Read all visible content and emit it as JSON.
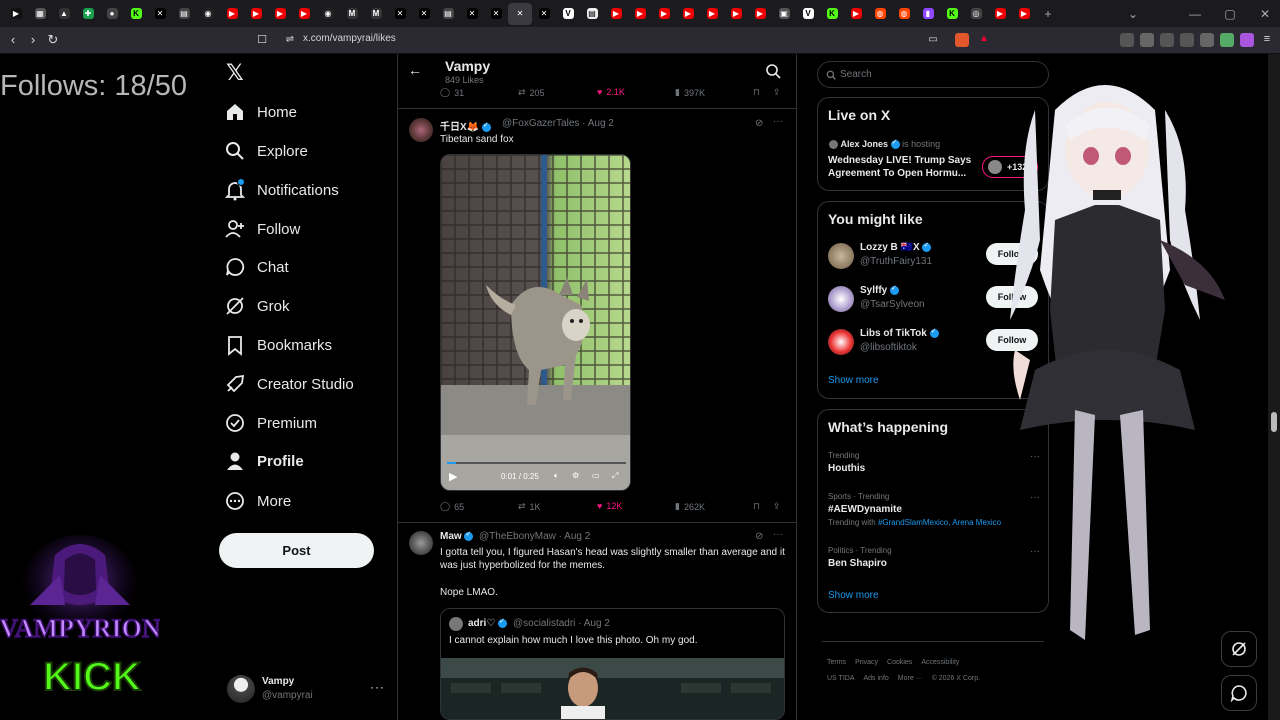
{
  "browser": {
    "url": "x.com/vampyrai/likes",
    "tabs": [
      {
        "icon": "play",
        "color": "#111"
      },
      {
        "icon": "tab",
        "color": "#555"
      },
      {
        "icon": "arrow",
        "color": "#333"
      },
      {
        "icon": "puzzle",
        "color": "#1a9e4f"
      },
      {
        "icon": "globe",
        "color": "#444"
      },
      {
        "icon": "kick",
        "color": "#53fc18"
      },
      {
        "icon": "x",
        "color": "#000"
      },
      {
        "icon": "doc",
        "color": "#444"
      },
      {
        "icon": "github",
        "color": "#222"
      },
      {
        "icon": "youtube",
        "color": "#e00"
      },
      {
        "icon": "youtube",
        "color": "#e00"
      },
      {
        "icon": "youtube",
        "color": "#e00"
      },
      {
        "icon": "youtube",
        "color": "#e00"
      },
      {
        "icon": "github",
        "color": "#222"
      },
      {
        "icon": "m",
        "color": "#333"
      },
      {
        "icon": "m",
        "color": "#333"
      },
      {
        "icon": "x",
        "color": "#000"
      },
      {
        "icon": "x",
        "color": "#000"
      },
      {
        "icon": "doc",
        "color": "#444"
      },
      {
        "icon": "x",
        "color": "#000"
      },
      {
        "icon": "x",
        "color": "#000"
      },
      {
        "icon": "close",
        "color": "#3a3a40",
        "active": true
      },
      {
        "icon": "x",
        "color": "#000"
      },
      {
        "icon": "v",
        "color": "#fff"
      },
      {
        "icon": "doc",
        "color": "#eee"
      },
      {
        "icon": "youtube",
        "color": "#e00"
      },
      {
        "icon": "youtube",
        "color": "#e00"
      },
      {
        "icon": "youtube",
        "color": "#e00"
      },
      {
        "icon": "youtube",
        "color": "#e00"
      },
      {
        "icon": "youtube",
        "color": "#e00"
      },
      {
        "icon": "youtube",
        "color": "#e00"
      },
      {
        "icon": "youtube",
        "color": "#e00"
      },
      {
        "icon": "img",
        "color": "#555"
      },
      {
        "icon": "v",
        "color": "#fff"
      },
      {
        "icon": "kick",
        "color": "#53fc18"
      },
      {
        "icon": "youtube",
        "color": "#e00"
      },
      {
        "icon": "reddit",
        "color": "#ff4500"
      },
      {
        "icon": "reddit",
        "color": "#ff4500"
      },
      {
        "icon": "twitch",
        "color": "#9146ff"
      },
      {
        "icon": "kick",
        "color": "#53fc18"
      },
      {
        "icon": "circle",
        "color": "#444"
      },
      {
        "icon": "youtube",
        "color": "#e00"
      },
      {
        "icon": "youtube",
        "color": "#e00"
      }
    ]
  },
  "overlay": {
    "follows": "Follows: 18/50",
    "logo_text_top": "VAMPYRION",
    "logo_text_bottom": "KICK"
  },
  "nav": {
    "items": [
      {
        "label": "Home",
        "icon": "home-icon"
      },
      {
        "label": "Explore",
        "icon": "search-icon"
      },
      {
        "label": "Notifications",
        "icon": "bell-icon"
      },
      {
        "label": "Follow",
        "icon": "follow-icon"
      },
      {
        "label": "Chat",
        "icon": "chat-icon"
      },
      {
        "label": "Grok",
        "icon": "grok-icon"
      },
      {
        "label": "Bookmarks",
        "icon": "bookmark-icon"
      },
      {
        "label": "Creator Studio",
        "icon": "rocket-icon"
      },
      {
        "label": "Premium",
        "icon": "premium-icon"
      },
      {
        "label": "Profile",
        "icon": "person-icon"
      },
      {
        "label": "More",
        "icon": "more-icon"
      }
    ],
    "post": "Post",
    "account": {
      "name": "Vampy",
      "handle": "@vampyrai"
    }
  },
  "header": {
    "name": "Vampy",
    "sub": "849 Likes"
  },
  "tweets": [
    {
      "actions": {
        "replies": "31",
        "reposts": "205",
        "likes": "2.1K",
        "views": "397K"
      }
    },
    {
      "name": "千日X🦊",
      "handle": "@FoxGazerTales · Aug 2",
      "text": "Tibetan sand fox",
      "video_time": "0:01 / 0:25",
      "actions": {
        "replies": "65",
        "reposts": "1K",
        "likes": "12K",
        "views": "262K"
      }
    },
    {
      "name": "Maw",
      "handle": "@TheEbonyMaw · Aug 2",
      "text1": "I gotta tell you, I figured Hasan's head was slightly smaller than average and it was just hyperbolized for the memes.",
      "text2": "Nope LMAO.",
      "quote": {
        "name": "adri♡",
        "handle": "@socialistadri · Aug 2",
        "text": "I cannot explain how much I love this photo. Oh my god."
      }
    }
  ],
  "right": {
    "search_placeholder": "Search",
    "live": {
      "title": "Live on X",
      "host": "Alex Jones",
      "host_suffix": "is hosting",
      "stream": "Wednesday LIVE! Trump Says Agreement To Open Hormu...",
      "count": "+132K"
    },
    "suggest": {
      "title": "You might like",
      "items": [
        {
          "name": "Lozzy B 🇦🇺X",
          "handle": "@TruthFairy131",
          "button": "Follow"
        },
        {
          "name": "Sylffy",
          "handle": "@TsarSylveon",
          "button": "Follow"
        },
        {
          "name": "Libs of TikTok",
          "handle": "@libsoftiktok",
          "button": "Follow"
        }
      ],
      "show_more": "Show more"
    },
    "happening": {
      "title": "What’s happening",
      "items": [
        {
          "context": "Trending",
          "topic": "Houthis",
          "with": ""
        },
        {
          "context": "Sports · Trending",
          "topic": "#AEWDynamite",
          "with_prefix": "Trending with",
          "with": "#GrandSlamMexico, Arena Mexico"
        },
        {
          "context": "Politics · Trending",
          "topic": "Ben Shapiro",
          "with": ""
        }
      ],
      "show_more": "Show more"
    },
    "footer": {
      "row1": [
        "Terms",
        "Privacy",
        "Cookies",
        "Accessibility"
      ],
      "row2": [
        "US TIDA",
        "Ads info",
        "More ···",
        "© 2026 X Corp."
      ]
    }
  },
  "colors": {
    "accent": "#1d9bf0",
    "like": "#f91880",
    "bg": "#000000",
    "border": "#2f3336"
  }
}
